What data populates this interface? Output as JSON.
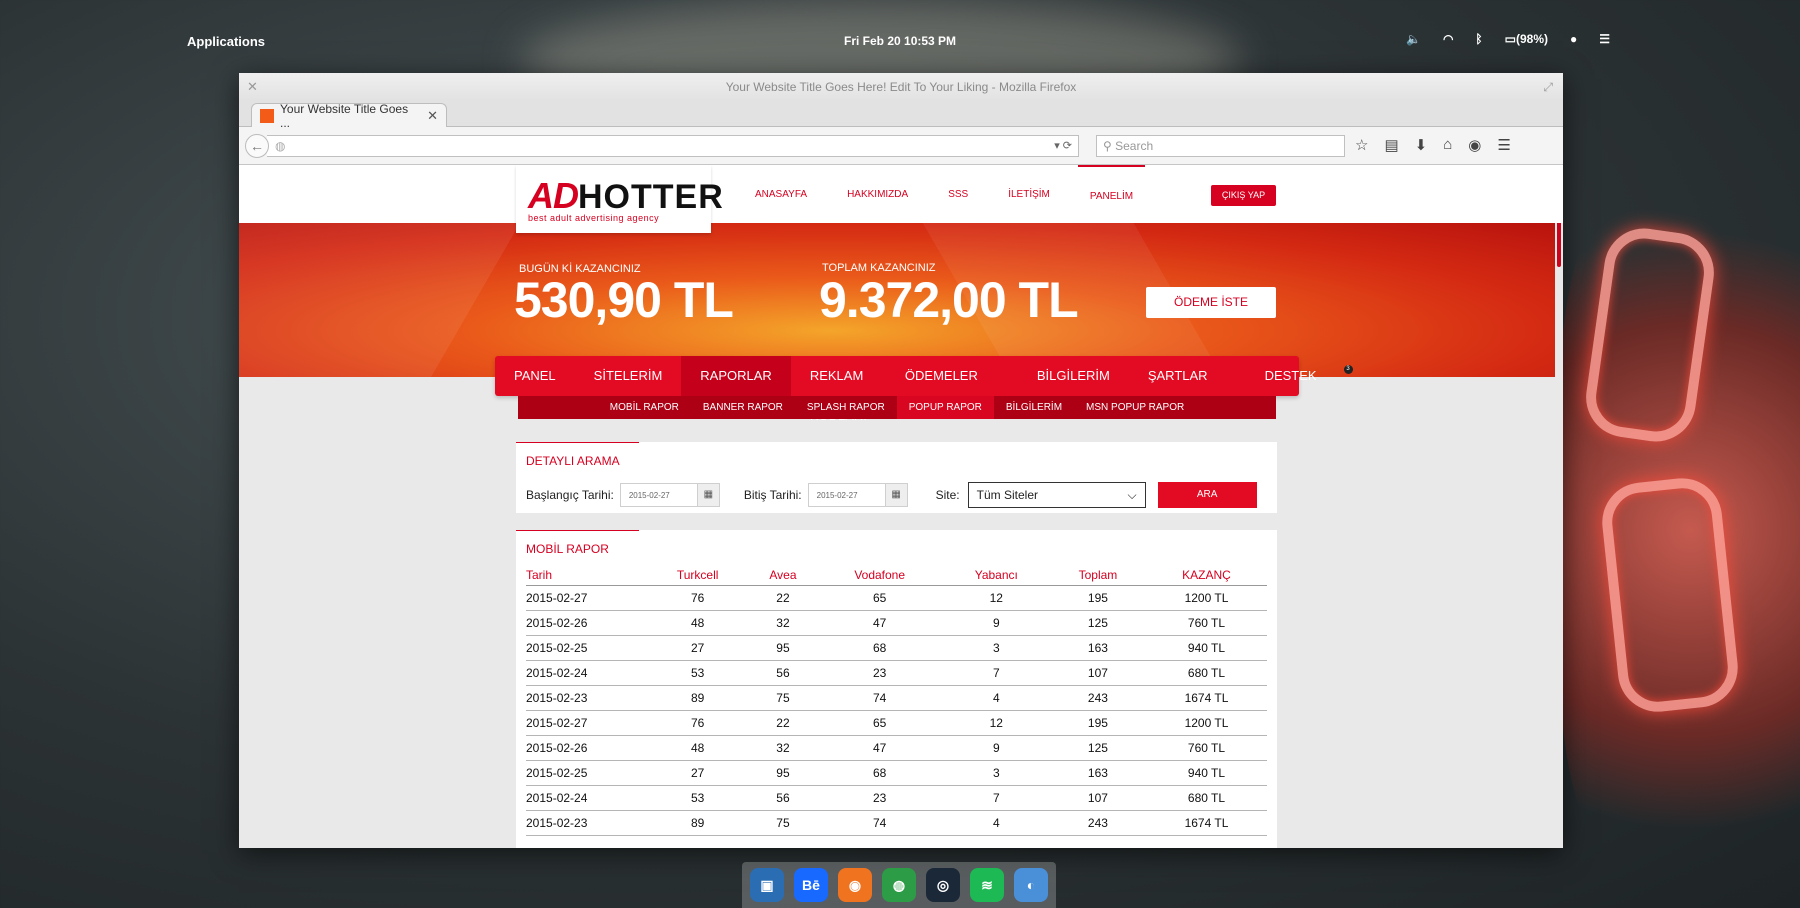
{
  "desktop": {
    "panel": {
      "applications_label": "Applications",
      "clock": "Fri Feb 20   10:53  PM",
      "battery": "(98%)"
    },
    "dock_icons": [
      {
        "name": "terminal-icon",
        "glyph": "▣",
        "color": "#2a6db3"
      },
      {
        "name": "behance-icon",
        "glyph": "Bē",
        "color": "#1769ff"
      },
      {
        "name": "firefox-icon",
        "glyph": "◉",
        "color": "#f0731f"
      },
      {
        "name": "chrome-icon",
        "glyph": "◍",
        "color": "#2c9c46"
      },
      {
        "name": "steam-icon",
        "glyph": "◎",
        "color": "#1b2838"
      },
      {
        "name": "spotify-icon",
        "glyph": "≋",
        "color": "#1db954"
      },
      {
        "name": "settings-toggle-icon",
        "glyph": "◐",
        "color": "#4a90d9"
      }
    ]
  },
  "browser": {
    "window_title": "Your Website Title Goes Here! Edit To Your Liking - Mozilla Firefox",
    "tab_title": "Your Website Title Goes  ...",
    "search_placeholder": "Search",
    "accent_color": "#d60020"
  },
  "site": {
    "logo": {
      "ad": "AD",
      "hotter": "HOTTER",
      "tagline": "best adult advertising agency"
    },
    "topnav": [
      "ANASAYFA",
      "HAKKIMIZDA",
      "SSS",
      "İLETİŞİM",
      "PANELİM"
    ],
    "topnav_active": "PANELİM",
    "logout_label": "ÇIKIŞ YAP",
    "today_label": "BUGÜN Kİ KAZANCINIZ",
    "today_value": "530,90 TL",
    "total_label": "TOPLAM KAZANCINIZ",
    "total_value": "9.372,00 TL",
    "pay_button": "ÖDEME İSTE",
    "mainnav": [
      "PANEL",
      "SİTELERİM",
      "RAPORLAR",
      "REKLAM KODLARI",
      "ÖDEMELER",
      "BİLGİLERİM",
      "ŞARTLAR",
      "DESTEK"
    ],
    "mainnav_active": "RAPORLAR",
    "support_badge": "3",
    "subnav": [
      "MOBİL RAPOR",
      "BANNER RAPOR",
      "SPLASH RAPOR",
      "POPUP RAPOR",
      "BİLGİLERİM",
      "MSN POPUP RAPOR"
    ],
    "subnav_active": "POPUP RAPOR"
  },
  "search_panel": {
    "title": "DETAYLI ARAMA",
    "start_label": "Başlangıç Tarihi:",
    "start_value": "2015-02-27",
    "end_label": "Bitiş Tarihi:",
    "end_value": "2015-02-27",
    "site_label": "Site:",
    "site_value": "Tüm Siteler",
    "search_button": "ARA"
  },
  "report": {
    "title": "MOBİL RAPOR",
    "columns": [
      "Tarih",
      "Turkcell",
      "Avea",
      "Vodafone",
      "Yabancı",
      "Toplam",
      "KAZANÇ"
    ],
    "rows": [
      [
        "2015-02-27",
        "76",
        "22",
        "65",
        "12",
        "195",
        "1200 TL"
      ],
      [
        "2015-02-26",
        "48",
        "32",
        "47",
        "9",
        "125",
        "760 TL"
      ],
      [
        "2015-02-25",
        "27",
        "95",
        "68",
        "3",
        "163",
        "940 TL"
      ],
      [
        "2015-02-24",
        "53",
        "56",
        "23",
        "7",
        "107",
        "680 TL"
      ],
      [
        "2015-02-23",
        "89",
        "75",
        "74",
        "4",
        "243",
        "1674 TL"
      ],
      [
        "2015-02-27",
        "76",
        "22",
        "65",
        "12",
        "195",
        "1200 TL"
      ],
      [
        "2015-02-26",
        "48",
        "32",
        "47",
        "9",
        "125",
        "760 TL"
      ],
      [
        "2015-02-25",
        "27",
        "95",
        "68",
        "3",
        "163",
        "940 TL"
      ],
      [
        "2015-02-24",
        "53",
        "56",
        "23",
        "7",
        "107",
        "680 TL"
      ],
      [
        "2015-02-23",
        "89",
        "75",
        "74",
        "4",
        "243",
        "1674 TL"
      ]
    ]
  }
}
